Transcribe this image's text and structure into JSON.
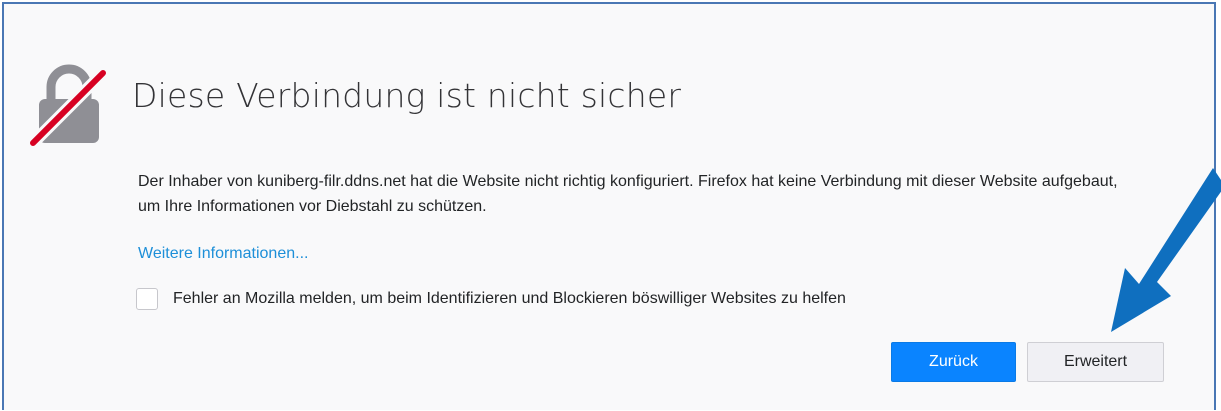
{
  "error_page": {
    "title": "Diese Verbindung ist nicht sicher",
    "description": "Der Inhaber von kuniberg-filr.ddns.net hat die Website nicht richtig konfiguriert. Firefox hat keine Verbindung mit dieser Website aufgebaut, um Ihre Informationen vor Diebstahl zu schützen.",
    "more_info_link": "Weitere Informationen...",
    "report_checkbox": {
      "label": "Fehler an Mozilla melden, um beim Identifizieren und Blockieren böswilliger Websites zu helfen",
      "checked": false
    },
    "buttons": {
      "back_label": "Zurück",
      "advanced_label": "Erweitert"
    }
  },
  "icons": {
    "lock": "broken-lock-icon",
    "arrow": "arrow-down-left-icon"
  },
  "colors": {
    "page_background": "#f9f9fa",
    "frame_border": "#4a77b4",
    "link": "#1d8fd8",
    "primary_button": "#0a84ff",
    "annotation_arrow": "#0f6fbf",
    "lock_gray": "#8f8f95",
    "strike_red": "#d70022"
  }
}
